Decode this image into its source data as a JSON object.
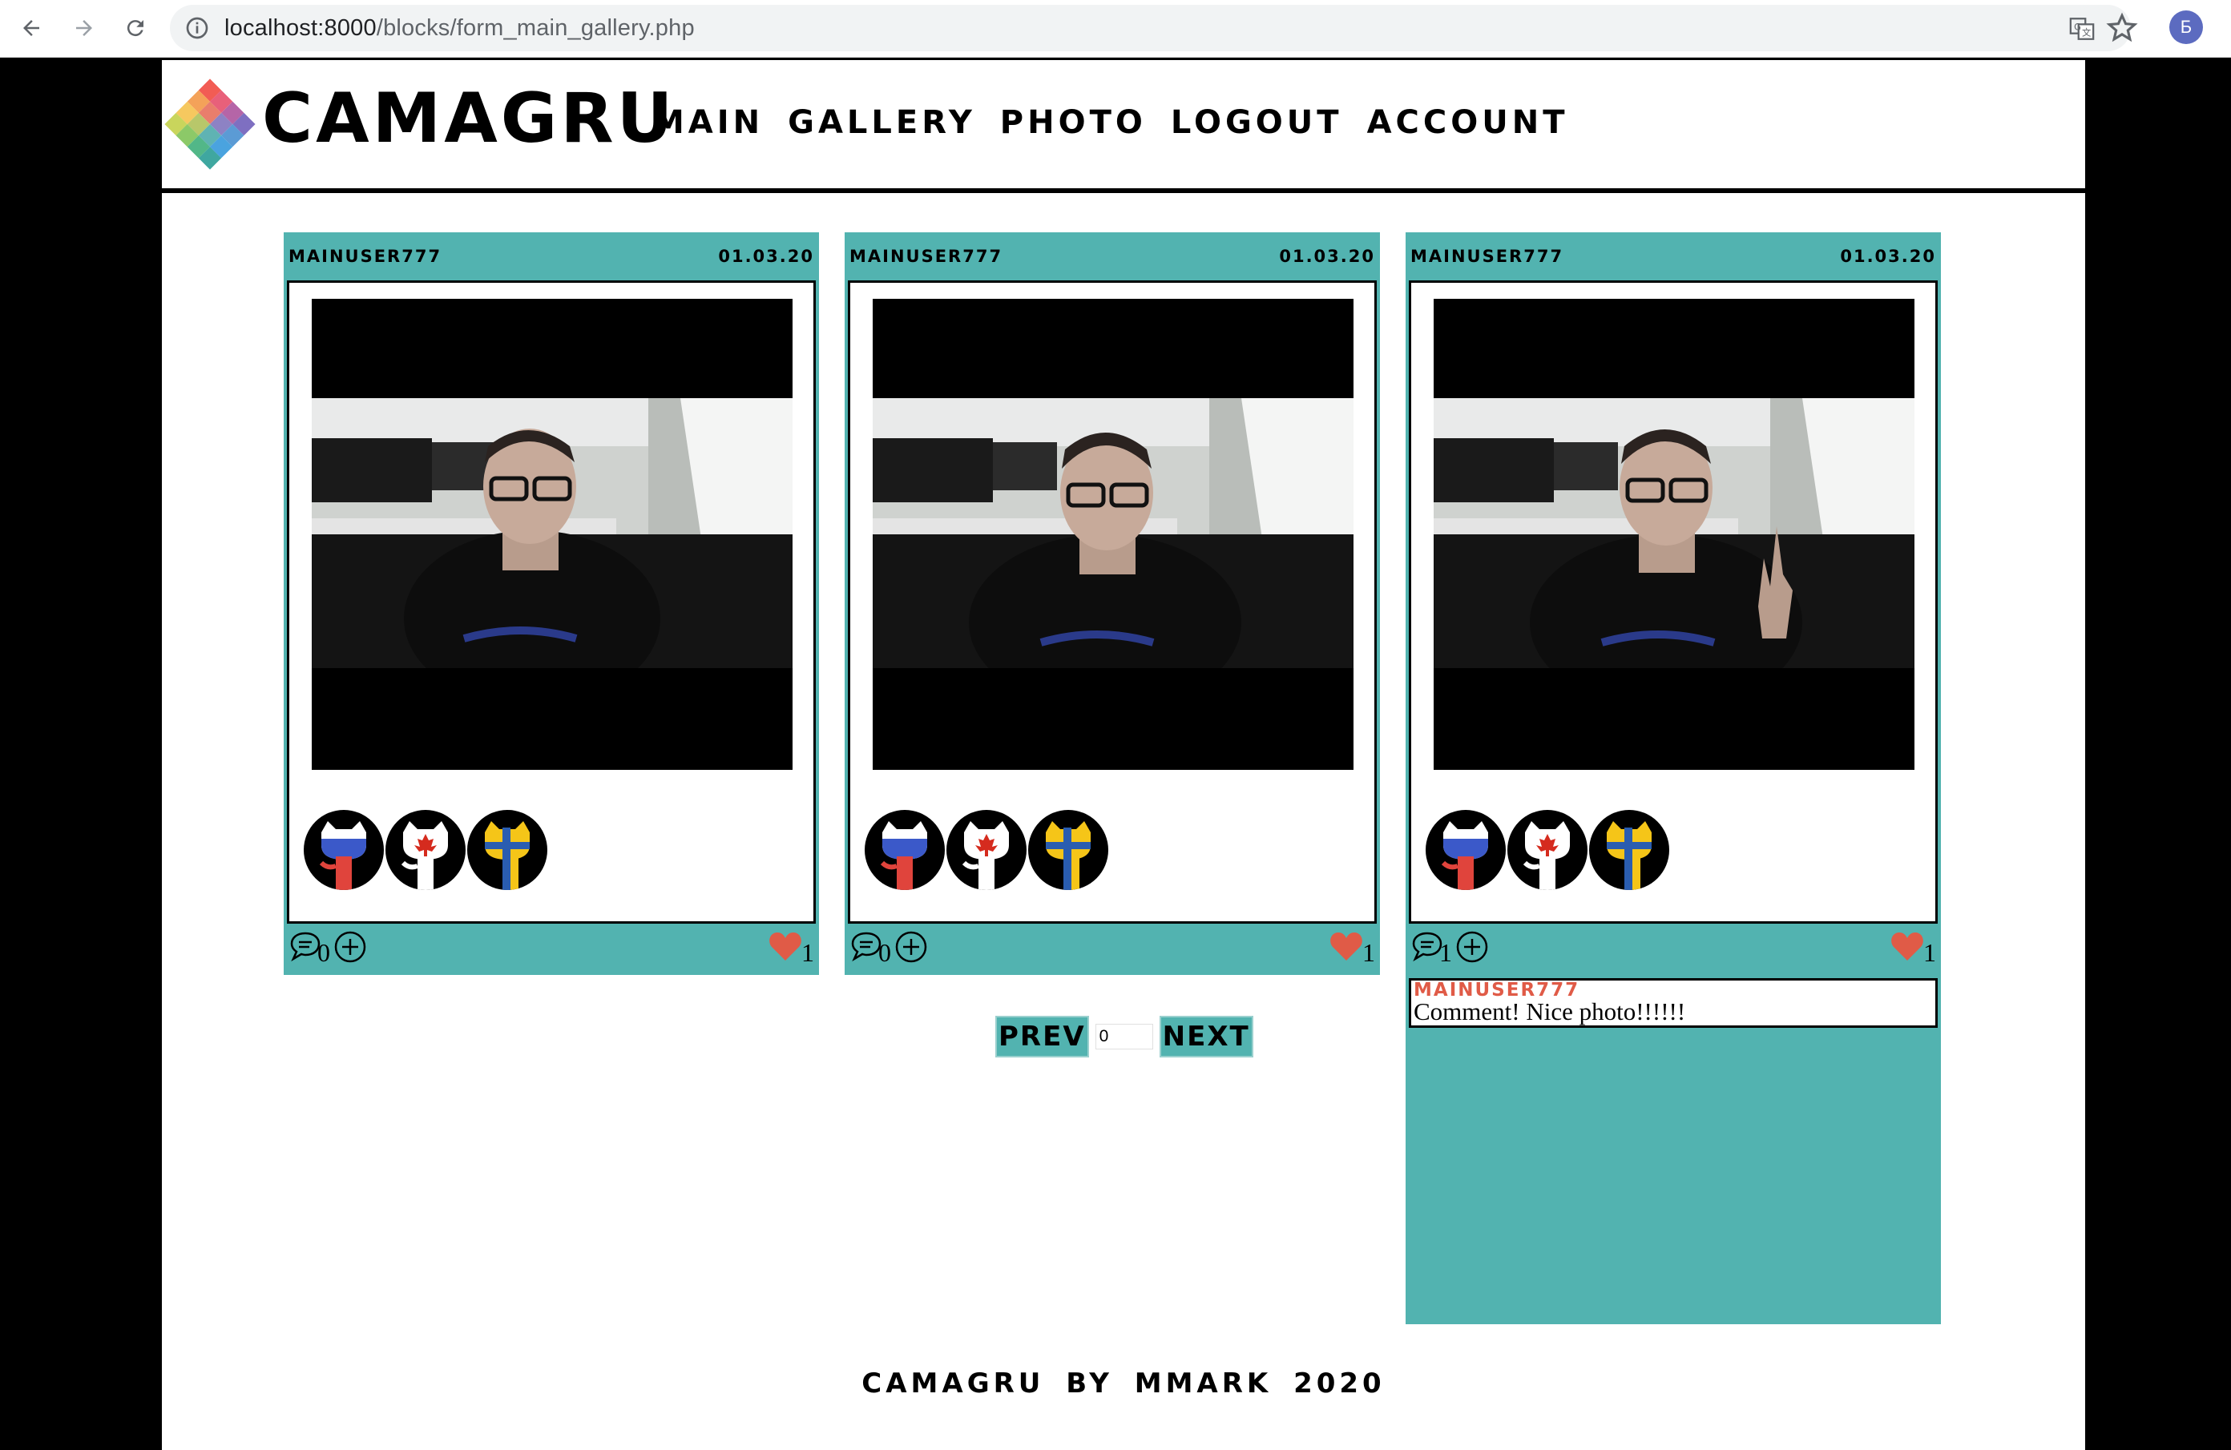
{
  "browser": {
    "url_host": "localhost:8000",
    "url_path": "/blocks/form_main_gallery.php",
    "profile_initial": "Б"
  },
  "header": {
    "logo_text": "CAMAGRU",
    "menu": [
      "MAIN",
      "GALLERY",
      "PHOTO",
      "LOGOUT",
      "ACCOUNT"
    ]
  },
  "cards": [
    {
      "username": "MAINUSER777",
      "date": "01.03.20",
      "comments": "0",
      "likes": "1"
    },
    {
      "username": "MAINUSER777",
      "date": "01.03.20",
      "comments": "0",
      "likes": "1"
    },
    {
      "username": "MAINUSER777",
      "date": "01.03.20",
      "comments": "1",
      "likes": "1",
      "comment_list": [
        {
          "author": "MAINUSER777",
          "text": "Comment! Nice photo!!!!!!"
        }
      ]
    }
  ],
  "pager": {
    "prev_label": "PREV",
    "next_label": "NEXT",
    "page_value": "0"
  },
  "footer": {
    "text": "CAMAGRU BY MMARK 2020"
  },
  "colors": {
    "card_bg": "#52b3b0",
    "heart": "#e05b47",
    "accent_text": "#e05b47"
  }
}
